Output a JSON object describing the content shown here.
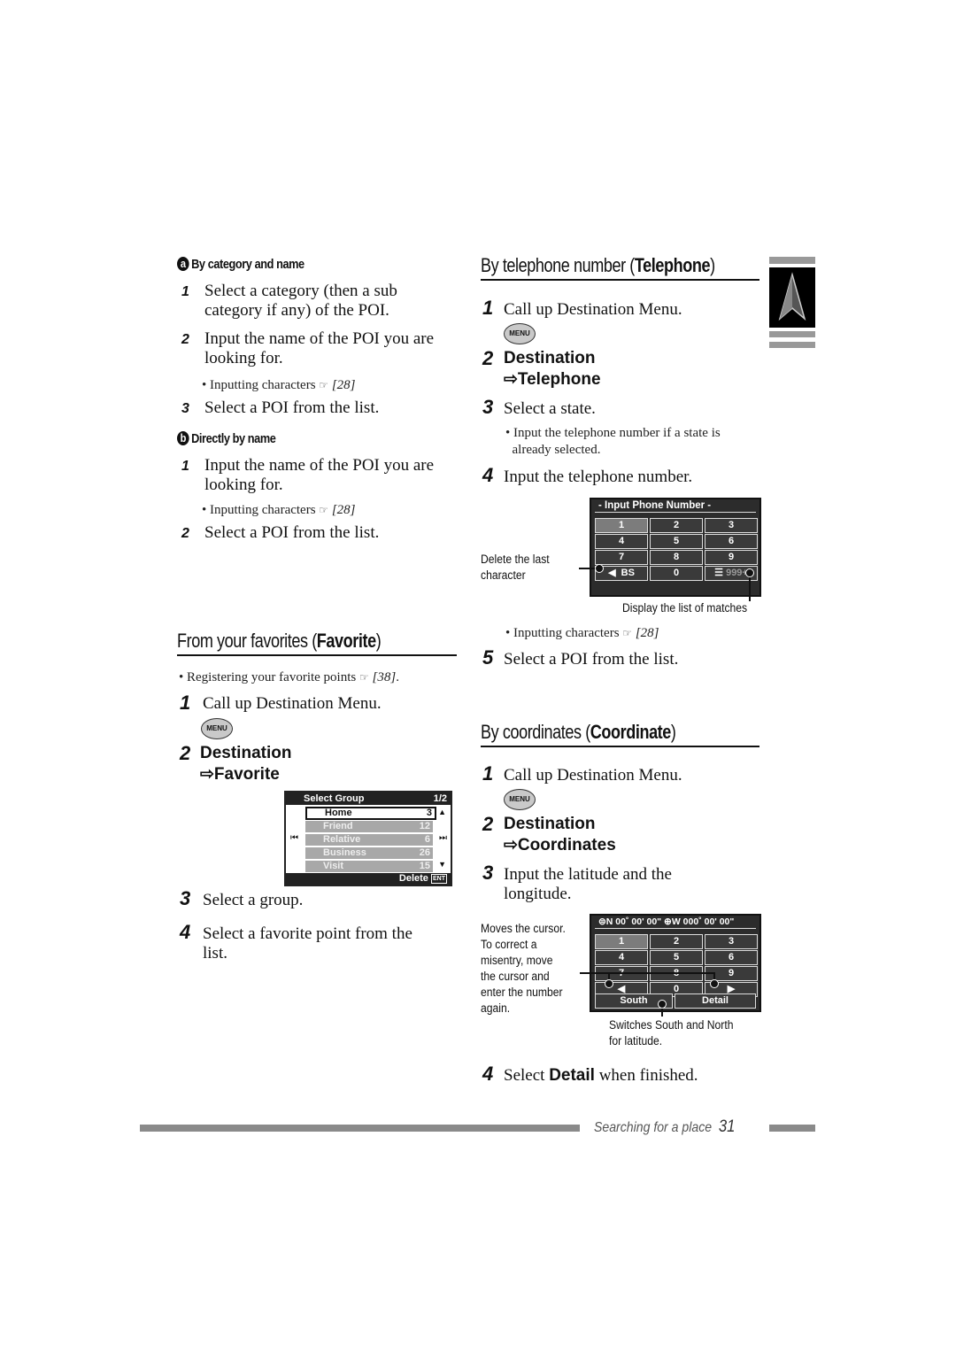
{
  "left": {
    "sub_a": {
      "letter": "a",
      "title": "By category and name"
    },
    "steps_a": [
      {
        "num": "1",
        "line1": "Select a category (then a sub",
        "line2": "category if any) of the POI."
      },
      {
        "num": "2",
        "line1": "Input the name of the POI you are",
        "line2": "looking for."
      },
      {
        "num": "3",
        "line1": "Select a POI from the list."
      }
    ],
    "bullet_a": {
      "text": "Inputting characters",
      "ref": "[28]"
    },
    "sub_b": {
      "letter": "b",
      "title": "Directly by name"
    },
    "steps_b": [
      {
        "num": "1",
        "line1": "Input the name of the POI you are",
        "line2": "looking for."
      },
      {
        "num": "2",
        "line1": "Select a POI from the list."
      }
    ],
    "bullet_b": {
      "text": "Inputting characters",
      "ref": "[28]"
    },
    "favorite": {
      "title_plain": "From your favorites (",
      "title_bold": "Favorite",
      "title_end": ")",
      "bullet": {
        "text": "Registering your favorite points",
        "ref": "[38]",
        "end": "."
      },
      "step1": {
        "num": "1",
        "text": "Call up Destination Menu."
      },
      "menu_button": "MENU",
      "step2": {
        "num": "2",
        "line1": "Destination",
        "line2": "⇨Favorite"
      },
      "screen": {
        "title": "Select Group",
        "page": "1/2",
        "rows": [
          {
            "name": "Home",
            "count": "3",
            "selected": true
          },
          {
            "name": "Friend",
            "count": "12"
          },
          {
            "name": "Relative",
            "count": "6"
          },
          {
            "name": "Business",
            "count": "26"
          },
          {
            "name": "Visit",
            "count": "15"
          }
        ],
        "footer": "Delete",
        "footer_icon": "ENT"
      },
      "step3": {
        "num": "3",
        "text": "Select a group."
      },
      "step4": {
        "num": "4",
        "line1": "Select a favorite point from the",
        "line2": "list."
      }
    }
  },
  "right": {
    "telephone": {
      "title_plain": "By telephone number (",
      "title_bold": "Telephone",
      "title_end": ")",
      "step1": {
        "num": "1",
        "text": "Call up Destination Menu."
      },
      "menu_button": "MENU",
      "step2": {
        "num": "2",
        "line1": "Destination",
        "line2": "⇨Telephone"
      },
      "step3": {
        "num": "3",
        "text": "Select a state."
      },
      "bullet3": {
        "line1": "Input the telephone number if a state is",
        "line2": "already selected."
      },
      "step4": {
        "num": "4",
        "text": "Input the telephone number."
      },
      "screen": {
        "title": "- Input Phone Number -",
        "keys": [
          "1",
          "2",
          "3",
          "4",
          "5",
          "6",
          "7",
          "8",
          "9",
          "BS",
          "0",
          "999+"
        ]
      },
      "note_left": {
        "line1": "Delete the last",
        "line2": "character"
      },
      "note_bottom": "Display the list of matches",
      "bullet4": {
        "text": "Inputting characters",
        "ref": "[28]"
      },
      "step5": {
        "num": "5",
        "text": "Select a POI from the list."
      }
    },
    "coordinate": {
      "title_plain": "By coordinates (",
      "title_bold": "Coordinate",
      "title_end": ")",
      "step1": {
        "num": "1",
        "text": "Call up Destination Menu."
      },
      "menu_button": "MENU",
      "step2": {
        "num": "2",
        "line1": "Destination",
        "line2": "⇨Coordinates"
      },
      "step3": {
        "num": "3",
        "line1": "Input the latitude and the",
        "line2": "longitude."
      },
      "screen": {
        "title": "⊜N 00˚ 00' 00\" ⊕W 000˚ 00' 00\"",
        "keys": [
          "1",
          "2",
          "3",
          "4",
          "5",
          "6",
          "7",
          "8",
          "9",
          "◀",
          "0",
          "▶"
        ],
        "south": "South",
        "detail": "Detail"
      },
      "note_left": [
        "Moves the cursor.",
        "To correct a",
        "misentry, move",
        "the cursor and",
        "enter the number",
        "again."
      ],
      "note_bottom": [
        "Switches South and North",
        "for latitude."
      ],
      "step4": {
        "num": "4",
        "pre": "Select ",
        "bold": "Detail",
        "post": " when finished."
      }
    }
  },
  "footer": {
    "section": "Searching for a place",
    "page": "31"
  },
  "tab_icon": "navigation-arrow-icon"
}
